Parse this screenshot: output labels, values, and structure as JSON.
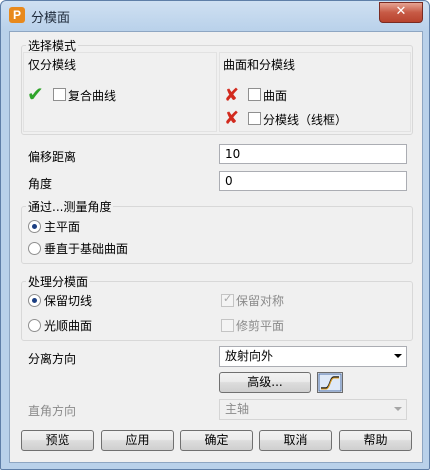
{
  "window": {
    "title": "分模面",
    "app_icon": "P",
    "close_label": "✕"
  },
  "select_mode": {
    "group_label": "选择模式",
    "parting_only_label": "仅分模线",
    "composite_curve_label": "复合曲线",
    "surface_and_parting_label": "曲面和分模线",
    "surface_label": "曲面",
    "parting_wireframe_label": "分模线（线框）"
  },
  "offset": {
    "label": "偏移距离",
    "value": "10"
  },
  "angle": {
    "label": "角度",
    "value": "0"
  },
  "measure_angle": {
    "group_label": "通过...测量角度",
    "options": [
      "主平面",
      "垂直于基础曲面"
    ],
    "selected": "主平面"
  },
  "process": {
    "group_label": "处理分模面",
    "keep_tangent_label": "保留切线",
    "smooth_surface_label": "光顺曲面",
    "keep_symmetry_label": "保留对称",
    "trim_plane_label": "修剪平面"
  },
  "parting_direction": {
    "label": "分离方向",
    "value": "放射向外",
    "advanced_label": "高级..."
  },
  "ortho_direction": {
    "label": "直角方向",
    "value": "主轴"
  },
  "buttons": {
    "preview": "预览",
    "apply": "应用",
    "ok": "确定",
    "cancel": "取消",
    "help": "帮助"
  },
  "colors": {
    "accent_check": "#2fa42a",
    "accent_cross": "#d22a1e",
    "radio_dot": "#1c3f82"
  },
  "icons": [
    "app-icon",
    "close-icon",
    "green-check-icon",
    "red-cross-icon",
    "curve-profile-icon",
    "dropdown-arrow-icon"
  ]
}
